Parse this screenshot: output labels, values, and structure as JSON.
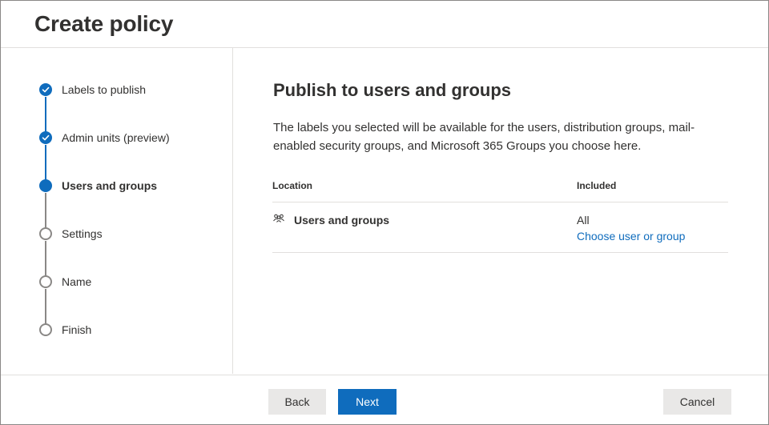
{
  "header": {
    "title": "Create policy"
  },
  "steps": [
    {
      "label": "Labels to publish",
      "state": "done"
    },
    {
      "label": "Admin units (preview)",
      "state": "done"
    },
    {
      "label": "Users and groups",
      "state": "current"
    },
    {
      "label": "Settings",
      "state": "todo"
    },
    {
      "label": "Name",
      "state": "todo"
    },
    {
      "label": "Finish",
      "state": "todo"
    }
  ],
  "main": {
    "title": "Publish to users and groups",
    "description": "The labels you selected will be available for the users, distribution groups, mail-enabled security groups, and Microsoft 365 Groups you choose here.",
    "table": {
      "columns": [
        "Location",
        "Included"
      ],
      "rows": [
        {
          "icon": "people-icon",
          "location": "Users and groups",
          "included": "All",
          "link": "Choose user or group"
        }
      ]
    }
  },
  "footer": {
    "back_label": "Back",
    "next_label": "Next",
    "cancel_label": "Cancel"
  },
  "colors": {
    "accent": "#0f6cbd",
    "inactive": "#8a8886",
    "text": "#323130"
  }
}
